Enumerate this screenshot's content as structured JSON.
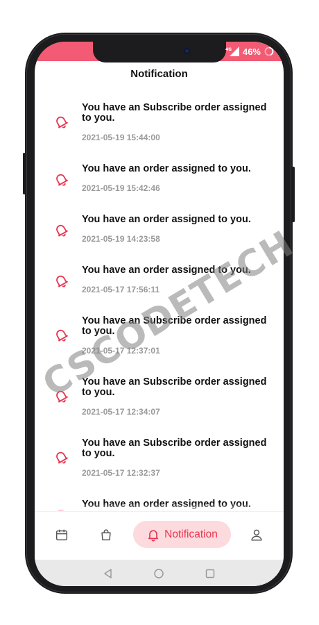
{
  "status_bar": {
    "network": "4G",
    "battery_percent": "46%"
  },
  "screen_title": "Notification",
  "notifications": [
    {
      "title": "You have an Subscribe order assigned to you.",
      "time": "2021-05-19 15:44:00"
    },
    {
      "title": "You have an order assigned to you.",
      "time": "2021-05-19 15:42:46"
    },
    {
      "title": "You have an order assigned to you.",
      "time": "2021-05-19 14:23:58"
    },
    {
      "title": "You have an order assigned to you.",
      "time": "2021-05-17 17:56:11"
    },
    {
      "title": "You have an Subscribe order assigned to you.",
      "time": "2021-05-17 12:37:01"
    },
    {
      "title": "You have an Subscribe order assigned to you.",
      "time": "2021-05-17 12:34:07"
    },
    {
      "title": "You have an Subscribe order assigned to you.",
      "time": "2021-05-17 12:32:37"
    },
    {
      "title": "You have an order assigned to you."
    }
  ],
  "bottom_nav": {
    "items": [
      {
        "icon": "calendar-icon"
      },
      {
        "icon": "shopping-bag-icon"
      },
      {
        "icon": "bell-icon",
        "label": "Notification",
        "active": true
      },
      {
        "icon": "user-icon"
      }
    ]
  },
  "system_nav": {
    "buttons": [
      "back-icon",
      "home-icon",
      "recents-icon"
    ]
  },
  "watermark": "CSCODETECH",
  "colors": {
    "accent": "#e8354f",
    "status_bar": "#f25b73",
    "pill": "#fcdadd",
    "muted": "#9a9a9a"
  }
}
